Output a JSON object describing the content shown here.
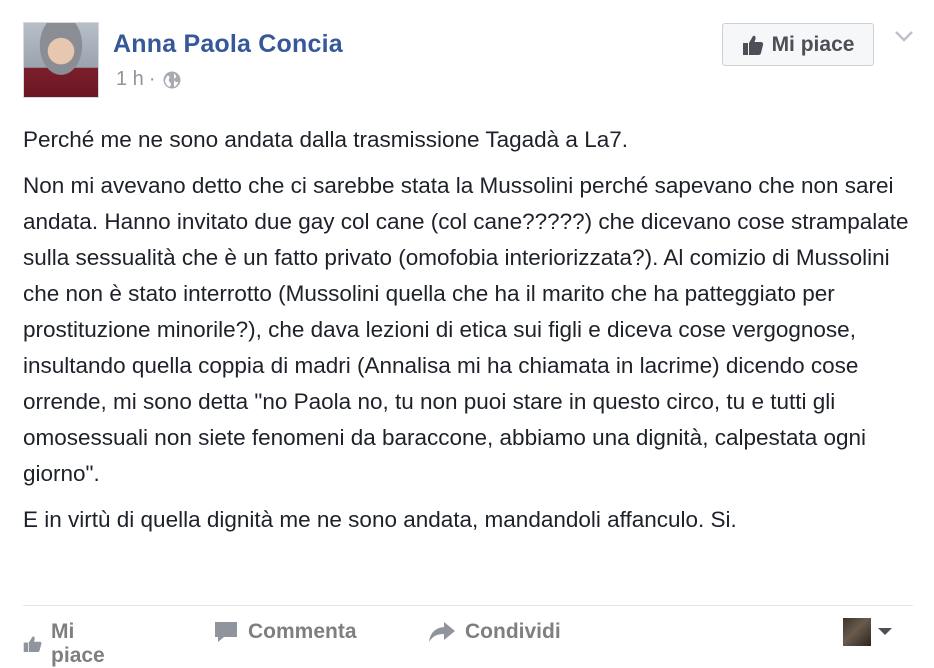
{
  "post": {
    "author": "Anna Paola Concia",
    "time": "1 h",
    "separator": "·",
    "privacy_icon": "globe-icon",
    "page_like_button": "Mi piace",
    "paragraphs": [
      "Perché me ne sono andata dalla trasmissione Tagadà a La7.",
      "Non mi avevano detto che ci sarebbe stata la Mussolini perché sapevano che non sarei andata. Hanno invitato due gay col cane (col cane?????) che dicevano cose strampalate sulla sessualità che è un fatto privato (omofobia interiorizzata?). Al comizio di Mussolini che non è stato interrotto (Mussolini quella che ha il marito che ha patteggiato per prostituzione minorile?), che dava lezioni di etica sui figli e diceva cose vergognose, insultando quella coppia di madri (Annalisa mi ha chiamata in lacrime) dicendo cose orrende, mi sono detta \"no Paola no, tu non puoi stare in questo circo, tu e tutti gli omosessuali non siete fenomeni da baraccone, abbiamo una dignità, calpestata ogni giorno\".",
      "E in virtù di quella dignità me ne sono andata, mandandoli affanculo. Si."
    ]
  },
  "actions": {
    "like": "Mi piace",
    "comment": "Commenta",
    "share": "Condividi"
  },
  "colors": {
    "author": "#365899",
    "muted": "#90949c",
    "action": "#7f7f7f"
  }
}
